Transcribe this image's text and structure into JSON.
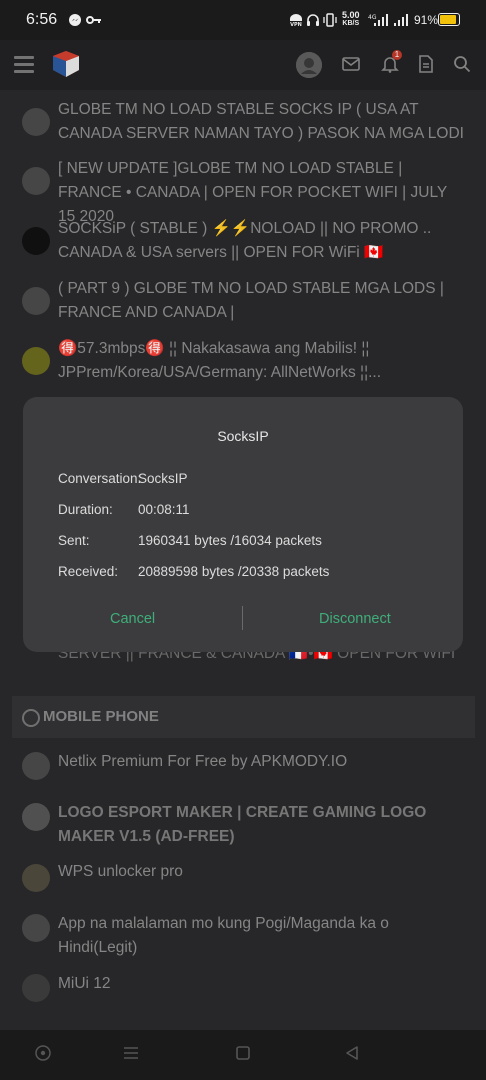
{
  "status_bar": {
    "time": "6:56",
    "speed_value": "5.00",
    "speed_unit": "KB/S",
    "battery": "91%",
    "icons": [
      "messenger-icon",
      "key-icon",
      "vpn-icon",
      "headset-icon",
      "vibrate-icon",
      "4g-signal-icon",
      "signal-icon",
      "battery-icon"
    ]
  },
  "app_bar": {
    "icons": [
      "menu-icon",
      "site-logo-icon",
      "avatar",
      "mail-icon",
      "bell-icon",
      "document-icon",
      "search-icon"
    ],
    "notification_count": "1"
  },
  "threads": [
    {
      "title": "GLOBE TM NO LOAD STABLE SOCKS IP ( USA AT CANADA SERVER NAMAN TAYO ) PASOK NA MGA LODI"
    },
    {
      "title": "[ NEW UPDATE ]GLOBE TM NO LOAD STABLE | FRANCE • CANADA | OPEN FOR POCKET WIFI | JULY 15 2020"
    },
    {
      "title": "SOCKSiP ( STABLE ) ⚡⚡NOLOAD || NO PROMO .. CANADA & USA servers || OPEN FOR WiFi 🇨🇦"
    },
    {
      "title": "( PART 9 ) GLOBE TM NO LOAD STABLE MGA LODS | FRANCE AND CANADA |"
    },
    {
      "title": "🉐57.3mbps🉐 ¦¦ Nakakasawa ang Mabilis! ¦¦ JPPrem/Korea/USA/Germany: AllNetWorks ¦¦..."
    },
    {
      "title": "SERVER || FRANCE & CANADA 🇫🇷•🇨🇦 OPEN FOR WIFI"
    }
  ],
  "section": {
    "title": "MOBILE PHONE"
  },
  "mobile_threads": [
    {
      "title": "Netlix Premium For Free by APKMODY.IO"
    },
    {
      "title": "LOGO ESPORT MAKER | CREATE GAMING LOGO MAKER V1.5 (AD-FREE)"
    },
    {
      "title": "WPS unlocker pro"
    },
    {
      "title": "App na malalaman mo kung Pogi/Maganda ka o Hindi(Legit)"
    },
    {
      "title": "MiUi 12"
    }
  ],
  "dialog": {
    "title": "SocksIP",
    "rows": [
      {
        "label": "Conversation:",
        "value": "SocksIP"
      },
      {
        "label": "Duration:",
        "value": "00:08:11"
      },
      {
        "label": "Sent:",
        "value": "1960341 bytes /16034 packets"
      },
      {
        "label": "Received:",
        "value": "20889598 bytes /20338 packets"
      }
    ],
    "cancel": "Cancel",
    "disconnect": "Disconnect",
    "accent": "#3fae7a"
  },
  "nav_bar": {
    "icons": [
      "screen-record-icon",
      "recent-apps-icon",
      "home-icon",
      "back-icon"
    ]
  }
}
